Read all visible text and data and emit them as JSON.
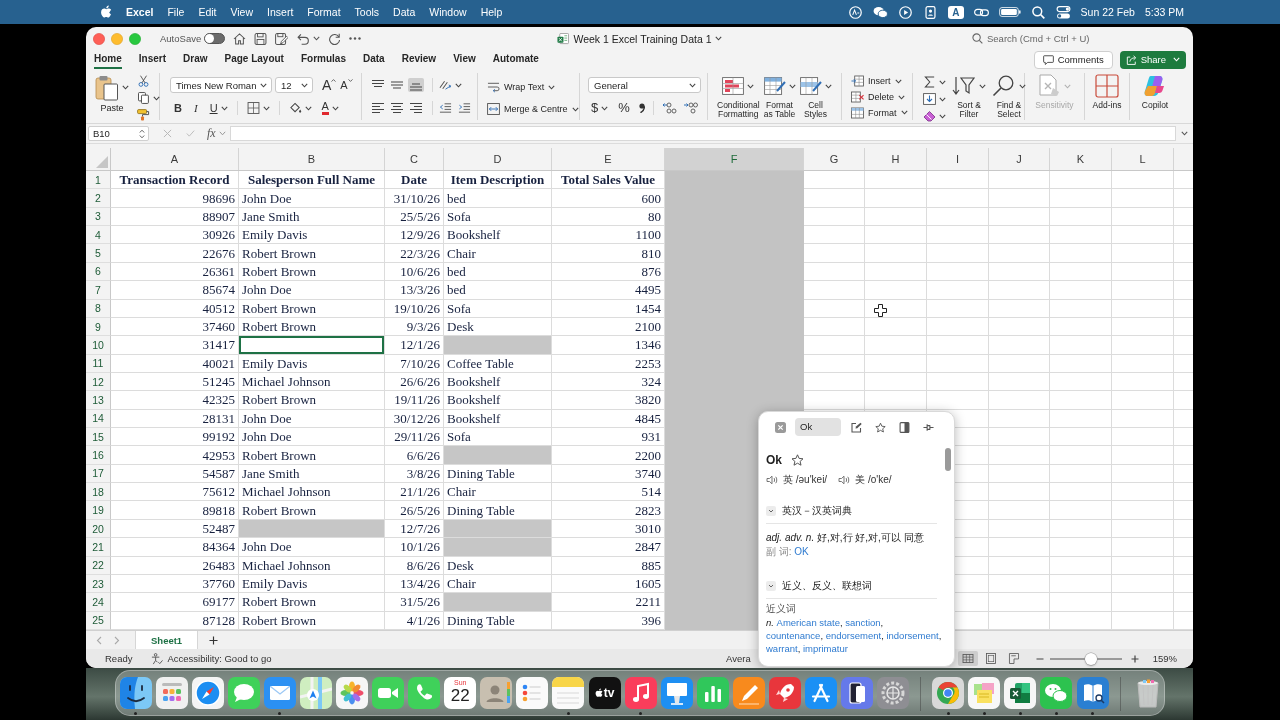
{
  "menu_bar": {
    "app": "Excel",
    "items": [
      "File",
      "Edit",
      "View",
      "Insert",
      "Format",
      "Tools",
      "Data",
      "Window",
      "Help"
    ],
    "input_source": "A",
    "date": "Sun 22 Feb",
    "time": "5:33 PM"
  },
  "window": {
    "title": "Week 1 Excel Training Data 1",
    "autosave": {
      "label": "AutoSave",
      "on": false
    },
    "search": {
      "placeholder": "Search (Cmd + Ctrl + U)"
    }
  },
  "tabs": [
    {
      "label": "Home",
      "selected": true
    },
    {
      "label": "Insert",
      "selected": false
    },
    {
      "label": "Draw",
      "selected": false
    },
    {
      "label": "Page Layout",
      "selected": false
    },
    {
      "label": "Formulas",
      "selected": false
    },
    {
      "label": "Data",
      "selected": false
    },
    {
      "label": "Review",
      "selected": false
    },
    {
      "label": "View",
      "selected": false
    },
    {
      "label": "Automate",
      "selected": false
    }
  ],
  "actions": {
    "comments": "Comments",
    "share": "Share"
  },
  "ribbon": {
    "clipboard": {
      "paste": "Paste"
    },
    "font": {
      "name": "Times New Roman",
      "size": "12",
      "grow": "A",
      "shrink": "A",
      "bold": "B",
      "italic": "I",
      "underline": "U",
      "font_color": "A"
    },
    "alignment": {
      "vertical": [
        {
          "kind": "top",
          "selected": false
        },
        {
          "kind": "middle",
          "selected": false
        },
        {
          "kind": "bottom",
          "selected": true
        }
      ],
      "horizontal": [
        {
          "kind": "left",
          "selected": false
        },
        {
          "kind": "center",
          "selected": false
        },
        {
          "kind": "right",
          "selected": false
        }
      ],
      "wrap_text": "Wrap Text",
      "merge": "Merge & Centre"
    },
    "number": {
      "format": "General",
      "currency": "$",
      "percent": "%"
    },
    "styles": [
      {
        "kind": "conditional",
        "label": "Conditional\nFormatting"
      },
      {
        "kind": "table",
        "label": "Format\nas Table"
      },
      {
        "kind": "cell",
        "label": "Cell\nStyles"
      }
    ],
    "cells": [
      {
        "kind": "insert",
        "label": "Insert"
      },
      {
        "kind": "delete",
        "label": "Delete"
      },
      {
        "kind": "format",
        "label": "Format"
      }
    ],
    "editing": [
      {
        "kind": "sort",
        "label": "Sort &\nFilter"
      },
      {
        "kind": "find",
        "label": "Find &\nSelect"
      }
    ],
    "extras": [
      {
        "kind": "sensitivity",
        "label": "Sensitivity",
        "disabled": true
      },
      {
        "kind": "addins",
        "label": "Add-ins",
        "disabled": false
      },
      {
        "kind": "copilot",
        "label": "Copilot",
        "disabled": false
      }
    ]
  },
  "formula_bar": {
    "name_box": "B10",
    "fx": "fx"
  },
  "columns": [
    {
      "letter": "A",
      "selected": false,
      "kind": "number"
    },
    {
      "letter": "B",
      "selected": false,
      "kind": "text"
    },
    {
      "letter": "C",
      "selected": false,
      "kind": "date"
    },
    {
      "letter": "D",
      "selected": false,
      "kind": "text"
    },
    {
      "letter": "E",
      "selected": false,
      "kind": "number"
    },
    {
      "letter": "F",
      "selected": true
    },
    {
      "letter": "G",
      "selected": false
    },
    {
      "letter": "H",
      "selected": false
    },
    {
      "letter": "I",
      "selected": false
    },
    {
      "letter": "J",
      "selected": false
    },
    {
      "letter": "K",
      "selected": false
    },
    {
      "letter": "L",
      "selected": false
    }
  ],
  "rows": [
    {
      "number": "1",
      "kind": "header",
      "cells": [
        {
          "text": "Transaction Record",
          "selected": false,
          "active": false
        },
        {
          "text": "Salesperson Full Name",
          "selected": false,
          "active": false
        },
        {
          "text": "Date",
          "selected": false,
          "active": false
        },
        {
          "text": "Item Description",
          "selected": false,
          "active": false
        },
        {
          "text": "Total Sales Value",
          "selected": false,
          "active": false
        }
      ]
    },
    {
      "number": "2",
      "kind": "data",
      "cells": [
        {
          "text": "98696",
          "selected": false,
          "active": false
        },
        {
          "text": "John Doe",
          "selected": false,
          "active": false
        },
        {
          "text": "31/10/26",
          "selected": false,
          "active": false
        },
        {
          "text": "bed",
          "selected": false,
          "active": false
        },
        {
          "text": "600",
          "selected": false,
          "active": false
        }
      ]
    },
    {
      "number": "3",
      "kind": "data",
      "cells": [
        {
          "text": "88907",
          "selected": false,
          "active": false
        },
        {
          "text": "Jane Smith",
          "selected": false,
          "active": false
        },
        {
          "text": "25/5/26",
          "selected": false,
          "active": false
        },
        {
          "text": "Sofa",
          "selected": false,
          "active": false
        },
        {
          "text": "80",
          "selected": false,
          "active": false
        }
      ]
    },
    {
      "number": "4",
      "kind": "data",
      "cells": [
        {
          "text": "30926",
          "selected": false,
          "active": false
        },
        {
          "text": "Emily Davis",
          "selected": false,
          "active": false
        },
        {
          "text": "12/9/26",
          "selected": false,
          "active": false
        },
        {
          "text": "Bookshelf",
          "selected": false,
          "active": false
        },
        {
          "text": "1100",
          "selected": false,
          "active": false
        }
      ]
    },
    {
      "number": "5",
      "kind": "data",
      "cells": [
        {
          "text": "22676",
          "selected": false,
          "active": false
        },
        {
          "text": "Robert Brown",
          "selected": false,
          "active": false
        },
        {
          "text": "22/3/26",
          "selected": false,
          "active": false
        },
        {
          "text": "Chair",
          "selected": false,
          "active": false
        },
        {
          "text": "810",
          "selected": false,
          "active": false
        }
      ]
    },
    {
      "number": "6",
      "kind": "data",
      "cells": [
        {
          "text": "26361",
          "selected": false,
          "active": false
        },
        {
          "text": "Robert Brown",
          "selected": false,
          "active": false
        },
        {
          "text": "10/6/26",
          "selected": false,
          "active": false
        },
        {
          "text": "bed",
          "selected": false,
          "active": false
        },
        {
          "text": "876",
          "selected": false,
          "active": false
        }
      ]
    },
    {
      "number": "7",
      "kind": "data",
      "cells": [
        {
          "text": "85674",
          "selected": false,
          "active": false
        },
        {
          "text": "John Doe",
          "selected": false,
          "active": false
        },
        {
          "text": "13/3/26",
          "selected": false,
          "active": false
        },
        {
          "text": "bed",
          "selected": false,
          "active": false
        },
        {
          "text": "4495",
          "selected": false,
          "active": false
        }
      ]
    },
    {
      "number": "8",
      "kind": "data",
      "cells": [
        {
          "text": "40512",
          "selected": false,
          "active": false
        },
        {
          "text": "Robert Brown",
          "selected": false,
          "active": false
        },
        {
          "text": "19/10/26",
          "selected": false,
          "active": false
        },
        {
          "text": "Sofa",
          "selected": false,
          "active": false
        },
        {
          "text": "1454",
          "selected": false,
          "active": false
        }
      ]
    },
    {
      "number": "9",
      "kind": "data",
      "cells": [
        {
          "text": "37460",
          "selected": false,
          "active": false
        },
        {
          "text": "Robert Brown",
          "selected": false,
          "active": false
        },
        {
          "text": "9/3/26",
          "selected": false,
          "active": false
        },
        {
          "text": "Desk",
          "selected": false,
          "active": false
        },
        {
          "text": "2100",
          "selected": false,
          "active": false
        }
      ]
    },
    {
      "number": "10",
      "kind": "data",
      "cells": [
        {
          "text": "31417",
          "selected": false,
          "active": false
        },
        {
          "selected": false,
          "active": true
        },
        {
          "text": "12/1/26",
          "selected": false,
          "active": false
        },
        {
          "selected": true,
          "active": false
        },
        {
          "text": "1346",
          "selected": false,
          "active": false
        }
      ]
    },
    {
      "number": "11",
      "kind": "data",
      "cells": [
        {
          "text": "40021",
          "selected": false,
          "active": false
        },
        {
          "text": "Emily Davis",
          "selected": false,
          "active": false
        },
        {
          "text": "7/10/26",
          "selected": false,
          "active": false
        },
        {
          "text": "Coffee Table",
          "selected": false,
          "active": false
        },
        {
          "text": "2253",
          "selected": false,
          "active": false
        }
      ]
    },
    {
      "number": "12",
      "kind": "data",
      "cells": [
        {
          "text": "51245",
          "selected": false,
          "active": false
        },
        {
          "text": "Michael Johnson",
          "selected": false,
          "active": false
        },
        {
          "text": "26/6/26",
          "selected": false,
          "active": false
        },
        {
          "text": "Bookshelf",
          "selected": false,
          "active": false
        },
        {
          "text": "324",
          "selected": false,
          "active": false
        }
      ]
    },
    {
      "number": "13",
      "kind": "data",
      "cells": [
        {
          "text": "42325",
          "selected": false,
          "active": false
        },
        {
          "text": "Robert Brown",
          "selected": false,
          "active": false
        },
        {
          "text": "19/11/26",
          "selected": false,
          "active": false
        },
        {
          "text": "Bookshelf",
          "selected": false,
          "active": false
        },
        {
          "text": "3820",
          "selected": false,
          "active": false
        }
      ]
    },
    {
      "number": "14",
      "kind": "data",
      "cells": [
        {
          "text": "28131",
          "selected": false,
          "active": false
        },
        {
          "text": "John Doe",
          "selected": false,
          "active": false
        },
        {
          "text": "30/12/26",
          "selected": false,
          "active": false
        },
        {
          "text": "Bookshelf",
          "selected": false,
          "active": false
        },
        {
          "text": "4845",
          "selected": false,
          "active": false
        }
      ]
    },
    {
      "number": "15",
      "kind": "data",
      "cells": [
        {
          "text": "99192",
          "selected": false,
          "active": false
        },
        {
          "text": "John Doe",
          "selected": false,
          "active": false
        },
        {
          "text": "29/11/26",
          "selected": false,
          "active": false
        },
        {
          "text": "Sofa",
          "selected": false,
          "active": false
        },
        {
          "text": "931",
          "selected": false,
          "active": false
        }
      ]
    },
    {
      "number": "16",
      "kind": "data",
      "cells": [
        {
          "text": "42953",
          "selected": false,
          "active": false
        },
        {
          "text": "Robert Brown",
          "selected": false,
          "active": false
        },
        {
          "text": "6/6/26",
          "selected": false,
          "active": false
        },
        {
          "selected": true,
          "active": false
        },
        {
          "text": "2200",
          "selected": false,
          "active": false
        }
      ]
    },
    {
      "number": "17",
      "kind": "data",
      "cells": [
        {
          "text": "54587",
          "selected": false,
          "active": false
        },
        {
          "text": "Jane Smith",
          "selected": false,
          "active": false
        },
        {
          "text": "3/8/26",
          "selected": false,
          "active": false
        },
        {
          "text": "Dining Table",
          "selected": false,
          "active": false
        },
        {
          "text": "3740",
          "selected": false,
          "active": false
        }
      ]
    },
    {
      "number": "18",
      "kind": "data",
      "cells": [
        {
          "text": "75612",
          "selected": false,
          "active": false
        },
        {
          "text": "Michael Johnson",
          "selected": false,
          "active": false
        },
        {
          "text": "21/1/26",
          "selected": false,
          "active": false
        },
        {
          "text": "Chair",
          "selected": false,
          "active": false
        },
        {
          "text": "514",
          "selected": false,
          "active": false
        }
      ]
    },
    {
      "number": "19",
      "kind": "data",
      "cells": [
        {
          "text": "89818",
          "selected": false,
          "active": false
        },
        {
          "text": "Robert Brown",
          "selected": false,
          "active": false
        },
        {
          "text": "26/5/26",
          "selected": false,
          "active": false
        },
        {
          "text": "Dining Table",
          "selected": false,
          "active": false
        },
        {
          "text": "2823",
          "selected": false,
          "active": false
        }
      ]
    },
    {
      "number": "20",
      "kind": "data",
      "cells": [
        {
          "text": "52487",
          "selected": false,
          "active": false
        },
        {
          "selected": true,
          "active": false
        },
        {
          "text": "12/7/26",
          "selected": false,
          "active": false
        },
        {
          "selected": true,
          "active": false
        },
        {
          "text": "3010",
          "selected": false,
          "active": false
        }
      ]
    },
    {
      "number": "21",
      "kind": "data",
      "cells": [
        {
          "text": "84364",
          "selected": false,
          "active": false
        },
        {
          "text": "John Doe",
          "selected": false,
          "active": false
        },
        {
          "text": "10/1/26",
          "selected": false,
          "active": false
        },
        {
          "selected": true,
          "active": false
        },
        {
          "text": "2847",
          "selected": false,
          "active": false
        }
      ]
    },
    {
      "number": "22",
      "kind": "data",
      "cells": [
        {
          "text": "26483",
          "selected": false,
          "active": false
        },
        {
          "text": "Michael Johnson",
          "selected": false,
          "active": false
        },
        {
          "text": "8/6/26",
          "selected": false,
          "active": false
        },
        {
          "text": "Desk",
          "selected": false,
          "active": false
        },
        {
          "text": "885",
          "selected": false,
          "active": false
        }
      ]
    },
    {
      "number": "23",
      "kind": "data",
      "cells": [
        {
          "text": "37760",
          "selected": false,
          "active": false
        },
        {
          "text": "Emily Davis",
          "selected": false,
          "active": false
        },
        {
          "text": "13/4/26",
          "selected": false,
          "active": false
        },
        {
          "text": "Chair",
          "selected": false,
          "active": false
        },
        {
          "text": "1605",
          "selected": false,
          "active": false
        }
      ]
    },
    {
      "number": "24",
      "kind": "data",
      "cells": [
        {
          "text": "69177",
          "selected": false,
          "active": false
        },
        {
          "text": "Robert Brown",
          "selected": false,
          "active": false
        },
        {
          "text": "31/5/26",
          "selected": false,
          "active": false
        },
        {
          "selected": true,
          "active": false
        },
        {
          "text": "2211",
          "selected": false,
          "active": false
        }
      ]
    },
    {
      "number": "25",
      "kind": "data",
      "cells": [
        {
          "text": "87128",
          "selected": false,
          "active": false
        },
        {
          "text": "Robert Brown",
          "selected": false,
          "active": false
        },
        {
          "text": "4/1/26",
          "selected": false,
          "active": false
        },
        {
          "text": "Dining Table",
          "selected": false,
          "active": false
        },
        {
          "text": "396",
          "selected": false,
          "active": false
        }
      ]
    }
  ],
  "sheets": [
    {
      "name": "Sheet1",
      "selected": true
    }
  ],
  "status_bar": {
    "mode": "Ready",
    "accessibility": "Accessibility: Good to go",
    "summary": "Avera",
    "views": [
      {
        "kind": "normal",
        "selected": true
      },
      {
        "kind": "page_layout",
        "selected": false
      },
      {
        "kind": "page_break",
        "selected": false
      }
    ],
    "zoom": {
      "level": 0.58,
      "reading": "159%"
    }
  },
  "dictionary_popup": {
    "query": "Ok",
    "headword": "Ok",
    "pronunciations": [
      {
        "region": "英",
        "ipa": "/əu'kei/"
      },
      {
        "region": "美",
        "ipa": "/o'ke/"
      }
    ],
    "sections": [
      {
        "kind": "definitions",
        "title": "英汉－汉英词典",
        "expanded": true,
        "definition": "*adj. adv. n.* 好,对,行 好,对,可以 同意",
        "derived_label": "副 词:",
        "derived_word": "OK"
      },
      {
        "kind": "related",
        "title": "近义、反义、联想词",
        "expanded": true,
        "group": "近义词",
        "pos": "n.",
        "words": [
          "American state",
          "sanction",
          "countenance",
          "endorsement",
          "indorsement",
          "warrant",
          "imprimatur"
        ],
        "separator": ","
      }
    ]
  },
  "dock": [
    {
      "kind": "finder",
      "running": true
    },
    {
      "kind": "launchpad",
      "running": false
    },
    {
      "kind": "safari",
      "running": false
    },
    {
      "kind": "messages",
      "running": false
    },
    {
      "kind": "mail",
      "running": true
    },
    {
      "kind": "maps",
      "running": false
    },
    {
      "kind": "photos",
      "running": false
    },
    {
      "kind": "facetime",
      "running": false
    },
    {
      "kind": "phone",
      "running": false
    },
    {
      "kind": "calendar",
      "running": false,
      "day": "Sun",
      "date": "22"
    },
    {
      "kind": "contacts",
      "running": false
    },
    {
      "kind": "reminders",
      "running": false
    },
    {
      "kind": "notes",
      "running": true
    },
    {
      "kind": "tv",
      "running": false,
      "label": "tv"
    },
    {
      "kind": "music",
      "running": true
    },
    {
      "kind": "keynote",
      "running": false
    },
    {
      "kind": "numbers",
      "running": false
    },
    {
      "kind": "pages",
      "running": false
    },
    {
      "kind": "rocket",
      "running": false
    },
    {
      "kind": "appstore",
      "running": false
    },
    {
      "kind": "mirroring",
      "running": false
    },
    {
      "kind": "settings",
      "running": false
    },
    {
      "kind": "separator"
    },
    {
      "kind": "chrome",
      "running": true
    },
    {
      "kind": "stickies",
      "running": true
    },
    {
      "kind": "excel",
      "running": true
    },
    {
      "kind": "wechat",
      "running": true
    },
    {
      "kind": "dictionary",
      "running": true
    },
    {
      "kind": "separator"
    },
    {
      "kind": "trash",
      "running": false
    }
  ]
}
